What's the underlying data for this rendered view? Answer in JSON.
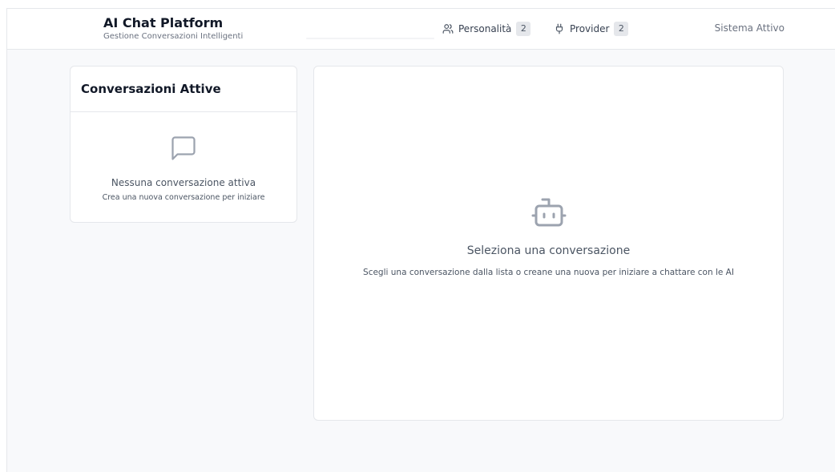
{
  "header": {
    "title": "AI Chat Platform",
    "subtitle": "Gestione Conversazioni Intelligenti",
    "nav": [
      {
        "label": "Personalità",
        "count": "2",
        "icon": "users-icon"
      },
      {
        "label": "Provider",
        "count": "2",
        "icon": "plug-icon"
      }
    ],
    "status": "Sistema Attivo"
  },
  "sidebar": {
    "title": "Conversazioni Attive",
    "empty_icon": "message-square-icon",
    "empty_title": "Nessuna conversazione attiva",
    "empty_subtitle": "Crea una nuova conversazione per iniziare"
  },
  "main": {
    "empty_icon": "bot-icon",
    "empty_title": "Seleziona una conversazione",
    "empty_subtitle": "Scegli una conversazione dalla lista o creane una nuova per iniziare a chattare con le AI"
  },
  "colors": {
    "background": "#f8f9fb",
    "card": "#ffffff",
    "border": "#e5e7eb",
    "muted_text": "#6b7280",
    "icon_gray": "#9ca3af"
  }
}
